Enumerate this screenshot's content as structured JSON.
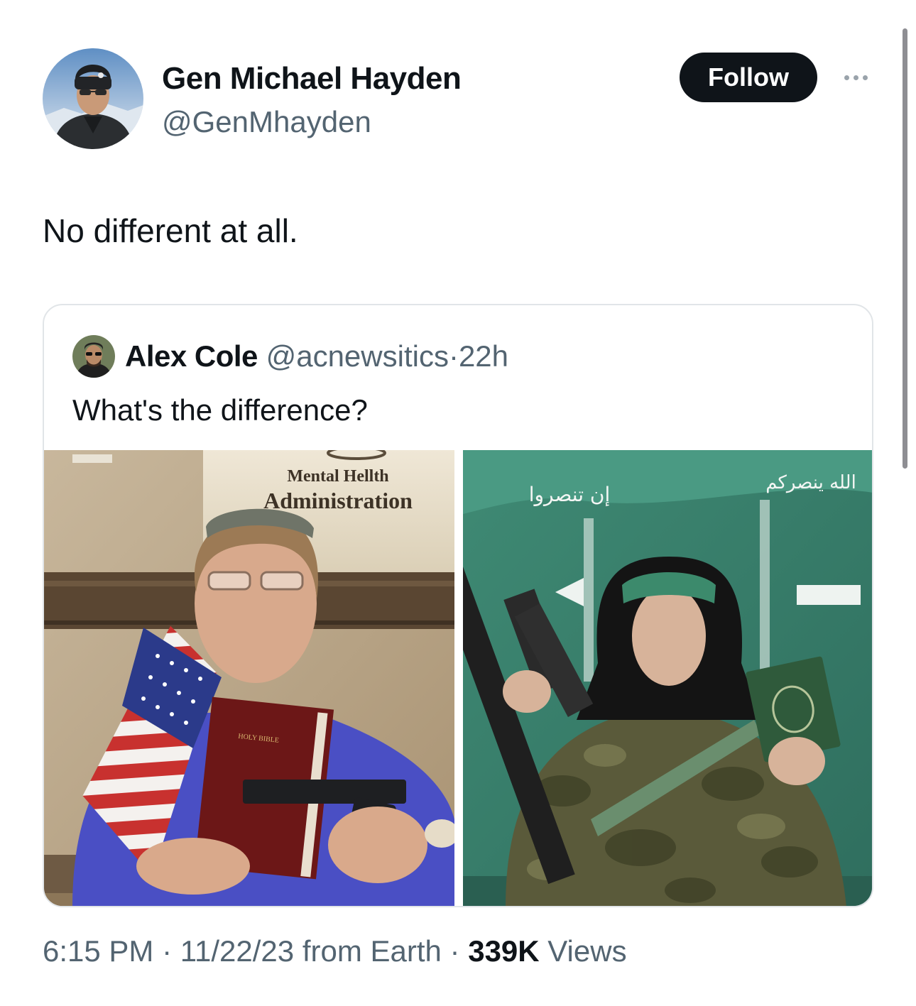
{
  "author": {
    "display_name": "Gen Michael Hayden",
    "handle": "@GenMhayden"
  },
  "actions": {
    "follow_label": "Follow"
  },
  "tweet": {
    "text": "No different at all."
  },
  "quoted_tweet": {
    "display_name": "Alex Cole",
    "handle": "@acnewsitics",
    "separator": "·",
    "time": "22h",
    "text": "What's the difference?",
    "images": {
      "left": {
        "sign_line1": "Mental Hellth",
        "sign_line2": "Administration",
        "book_label": "HOLY BIBLE"
      },
      "right": {
        "banner_text_left": "إن تنصروا",
        "banner_text_right": "الله ينصركم"
      }
    }
  },
  "meta": {
    "time": "6:15 PM",
    "sep1": "·",
    "date": "11/22/23",
    "source": "from Earth",
    "sep2": "·",
    "views_count": "339K",
    "views_label": "Views"
  },
  "colors": {
    "text_primary": "#0f1419",
    "text_secondary": "#536471",
    "border": "#e1e5e8",
    "follow_bg": "#0f1419"
  },
  "icons": {
    "more": "more-horizontal-icon"
  }
}
